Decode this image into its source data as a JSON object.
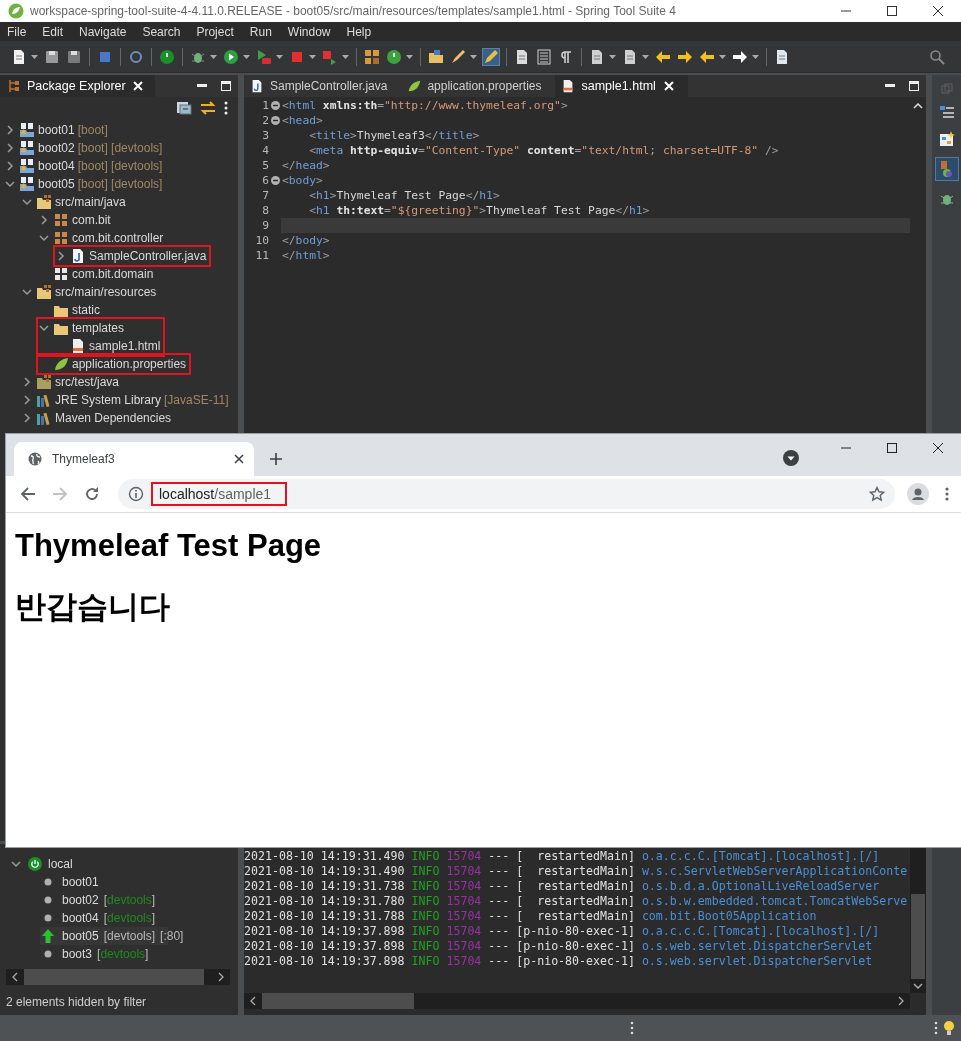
{
  "window": {
    "title": "workspace-spring-tool-suite-4-4.11.0.RELEASE - boot05/src/main/resources/templates/sample1.html - Spring Tool Suite 4"
  },
  "menu": [
    "File",
    "Edit",
    "Navigate",
    "Search",
    "Project",
    "Run",
    "Window",
    "Help"
  ],
  "package_explorer": {
    "title": "Package Explorer",
    "tree": [
      {
        "label": "boot01",
        "note": "[boot]",
        "kind": "project",
        "expanded": false,
        "highlighted": false
      },
      {
        "label": "boot02",
        "note": "[boot] [devtools]",
        "kind": "project",
        "expanded": false,
        "highlighted": false
      },
      {
        "label": "boot04",
        "note": "[boot] [devtools]",
        "kind": "project",
        "expanded": false,
        "highlighted": false
      },
      {
        "label": "boot05",
        "note": "[boot] [devtools]",
        "kind": "project",
        "expanded": true,
        "highlighted": false,
        "children": [
          {
            "label": "src/main/java",
            "kind": "source-folder",
            "expanded": true,
            "highlighted": false,
            "children": [
              {
                "label": "com.bit",
                "kind": "package",
                "expanded": false,
                "highlighted": false
              },
              {
                "label": "com.bit.controller",
                "kind": "package",
                "expanded": true,
                "highlighted": false,
                "children": [
                  {
                    "label": "SampleController.java",
                    "kind": "java-file",
                    "expanded": false,
                    "highlighted": true
                  }
                ]
              },
              {
                "label": "com.bit.domain",
                "kind": "empty-package",
                "highlighted": false
              }
            ]
          },
          {
            "label": "src/main/resources",
            "kind": "source-folder",
            "expanded": true,
            "highlighted": false,
            "children": [
              {
                "label": "static",
                "kind": "folder",
                "highlighted": false
              },
              {
                "label": "templates",
                "kind": "folder",
                "expanded": true,
                "highlighted": true,
                "children": [
                  {
                    "label": "sample1.html",
                    "kind": "html-file",
                    "highlighted": false
                  }
                ]
              },
              {
                "label": "application.properties",
                "kind": "properties-file",
                "highlighted": true
              }
            ]
          },
          {
            "label": "src/test/java",
            "kind": "test-folder",
            "expanded": false,
            "highlighted": false
          },
          {
            "label": "JRE System Library",
            "note": "[JavaSE-11]",
            "kind": "library",
            "expanded": false,
            "highlighted": false
          },
          {
            "label": "Maven Dependencies",
            "kind": "library",
            "expanded": false,
            "highlighted": false
          }
        ]
      }
    ]
  },
  "editor": {
    "tabs": [
      {
        "label": "SampleController.java",
        "kind": "java-file",
        "selected": false
      },
      {
        "label": "application.properties",
        "kind": "properties-file",
        "selected": false
      },
      {
        "label": "sample1.html",
        "kind": "html-file",
        "selected": true
      }
    ],
    "lines": [
      {
        "number": "1",
        "fold": true,
        "current": false,
        "tokens": [
          {
            "text": "<",
            "kind": "punct"
          },
          {
            "text": "html",
            "kind": "tag"
          },
          {
            "text": " xmlns:th",
            "kind": "attr"
          },
          {
            "text": "=",
            "kind": "punct"
          },
          {
            "text": "\"http://www.thymeleaf.org\"",
            "kind": "string"
          },
          {
            "text": ">",
            "kind": "punct"
          }
        ]
      },
      {
        "number": "2",
        "fold": true,
        "current": false,
        "tokens": [
          {
            "text": "<",
            "kind": "punct"
          },
          {
            "text": "head",
            "kind": "tag"
          },
          {
            "text": ">",
            "kind": "punct"
          }
        ]
      },
      {
        "number": "3",
        "fold": false,
        "current": false,
        "tokens": [
          {
            "text": "    <",
            "kind": "punct"
          },
          {
            "text": "title",
            "kind": "tag"
          },
          {
            "text": ">",
            "kind": "punct"
          },
          {
            "text": "Thymeleaf3",
            "kind": "text"
          },
          {
            "text": "</",
            "kind": "punct"
          },
          {
            "text": "title",
            "kind": "tag"
          },
          {
            "text": ">",
            "kind": "punct"
          }
        ]
      },
      {
        "number": "4",
        "fold": false,
        "current": false,
        "tokens": [
          {
            "text": "    <",
            "kind": "punct"
          },
          {
            "text": "meta",
            "kind": "tag"
          },
          {
            "text": " http-equiv",
            "kind": "attr"
          },
          {
            "text": "=",
            "kind": "punct"
          },
          {
            "text": "\"Content-Type\"",
            "kind": "string"
          },
          {
            "text": " content",
            "kind": "attr"
          },
          {
            "text": "=",
            "kind": "punct"
          },
          {
            "text": "\"text/html; charset=UTF-8\"",
            "kind": "string"
          },
          {
            "text": " />",
            "kind": "punct"
          }
        ]
      },
      {
        "number": "5",
        "fold": false,
        "current": false,
        "tokens": [
          {
            "text": "</",
            "kind": "punct"
          },
          {
            "text": "head",
            "kind": "tag"
          },
          {
            "text": ">",
            "kind": "punct"
          }
        ]
      },
      {
        "number": "6",
        "fold": true,
        "current": false,
        "tokens": [
          {
            "text": "<",
            "kind": "punct"
          },
          {
            "text": "body",
            "kind": "tag"
          },
          {
            "text": ">",
            "kind": "punct"
          }
        ]
      },
      {
        "number": "7",
        "fold": false,
        "current": false,
        "tokens": [
          {
            "text": "    <",
            "kind": "punct"
          },
          {
            "text": "h1",
            "kind": "tag"
          },
          {
            "text": ">",
            "kind": "punct"
          },
          {
            "text": "Thymeleaf Test Page",
            "kind": "text"
          },
          {
            "text": "</",
            "kind": "punct"
          },
          {
            "text": "h1",
            "kind": "tag"
          },
          {
            "text": ">",
            "kind": "punct"
          }
        ]
      },
      {
        "number": "8",
        "fold": false,
        "current": false,
        "tokens": [
          {
            "text": "    <",
            "kind": "punct"
          },
          {
            "text": "h1",
            "kind": "tag"
          },
          {
            "text": " th:text",
            "kind": "attr"
          },
          {
            "text": "=",
            "kind": "punct"
          },
          {
            "text": "\"${greeting}\"",
            "kind": "string"
          },
          {
            "text": ">",
            "kind": "punct"
          },
          {
            "text": "Thymeleaf Test Page",
            "kind": "text"
          },
          {
            "text": "</",
            "kind": "punct"
          },
          {
            "text": "h1",
            "kind": "tag"
          },
          {
            "text": ">",
            "kind": "punct"
          }
        ]
      },
      {
        "number": "9",
        "fold": false,
        "current": true
      },
      {
        "number": "10",
        "fold": false,
        "current": false,
        "tokens": [
          {
            "text": "</",
            "kind": "punct"
          },
          {
            "text": "body",
            "kind": "tag"
          },
          {
            "text": ">",
            "kind": "punct"
          }
        ]
      },
      {
        "number": "11",
        "fold": false,
        "current": false,
        "tokens": [
          {
            "text": "</",
            "kind": "punct"
          },
          {
            "text": "html",
            "kind": "tag"
          },
          {
            "text": ">",
            "kind": "punct"
          }
        ]
      }
    ]
  },
  "boot_dashboard": {
    "group": {
      "label": "local",
      "expanded": true
    },
    "apps": [
      {
        "name": "boot01",
        "running": false
      },
      {
        "name": "boot02",
        "tag": "[devtools]",
        "running": false
      },
      {
        "name": "boot04",
        "tag": "[devtools]",
        "running": false
      },
      {
        "name": "boot05",
        "tag": "[devtools]",
        "port": "[:80]",
        "running": true
      },
      {
        "name": "boot3",
        "tag": "[devtools]",
        "running": false
      }
    ],
    "filter_status": "2 elements hidden by filter"
  },
  "console": {
    "lines": [
      {
        "time": "2021-08-10 14:19:31.490",
        "level": "INFO",
        "pid": "15704",
        "sep": "---",
        "thread": "[  restartedMain]",
        "logger": "o.a.c.c.C.[Tomcat].[localhost].[/]"
      },
      {
        "time": "2021-08-10 14:19:31.490",
        "level": "INFO",
        "pid": "15704",
        "sep": "---",
        "thread": "[  restartedMain]",
        "logger": "w.s.c.ServletWebServerApplicationConte"
      },
      {
        "time": "2021-08-10 14:19:31.738",
        "level": "INFO",
        "pid": "15704",
        "sep": "---",
        "thread": "[  restartedMain]",
        "logger": "o.s.b.d.a.OptionalLiveReloadServer"
      },
      {
        "time": "2021-08-10 14:19:31.780",
        "level": "INFO",
        "pid": "15704",
        "sep": "---",
        "thread": "[  restartedMain]",
        "logger": "o.s.b.w.embedded.tomcat.TomcatWebServe"
      },
      {
        "time": "2021-08-10 14:19:31.788",
        "level": "INFO",
        "pid": "15704",
        "sep": "---",
        "thread": "[  restartedMain]",
        "logger": "com.bit.Boot05Application"
      },
      {
        "time": "2021-08-10 14:19:37.898",
        "level": "INFO",
        "pid": "15704",
        "sep": "---",
        "thread": "[p-nio-80-exec-1]",
        "logger": "o.a.c.c.C.[Tomcat].[localhost].[/]"
      },
      {
        "time": "2021-08-10 14:19:37.898",
        "level": "INFO",
        "pid": "15704",
        "sep": "---",
        "thread": "[p-nio-80-exec-1]",
        "logger": "o.s.web.servlet.DispatcherServlet"
      },
      {
        "time": "2021-08-10 14:19:37.898",
        "level": "INFO",
        "pid": "15704",
        "sep": "---",
        "thread": "[p-nio-80-exec-1]",
        "logger": "o.s.web.servlet.DispatcherServlet"
      }
    ]
  },
  "browser": {
    "tabs": [
      {
        "title": "Thymeleaf3",
        "selected": true
      }
    ],
    "address": {
      "host": "localhost",
      "path": "/sample1",
      "highlighted": true
    },
    "page": {
      "headings": [
        "Thymeleaf Test Page",
        "반갑습니다"
      ]
    }
  }
}
